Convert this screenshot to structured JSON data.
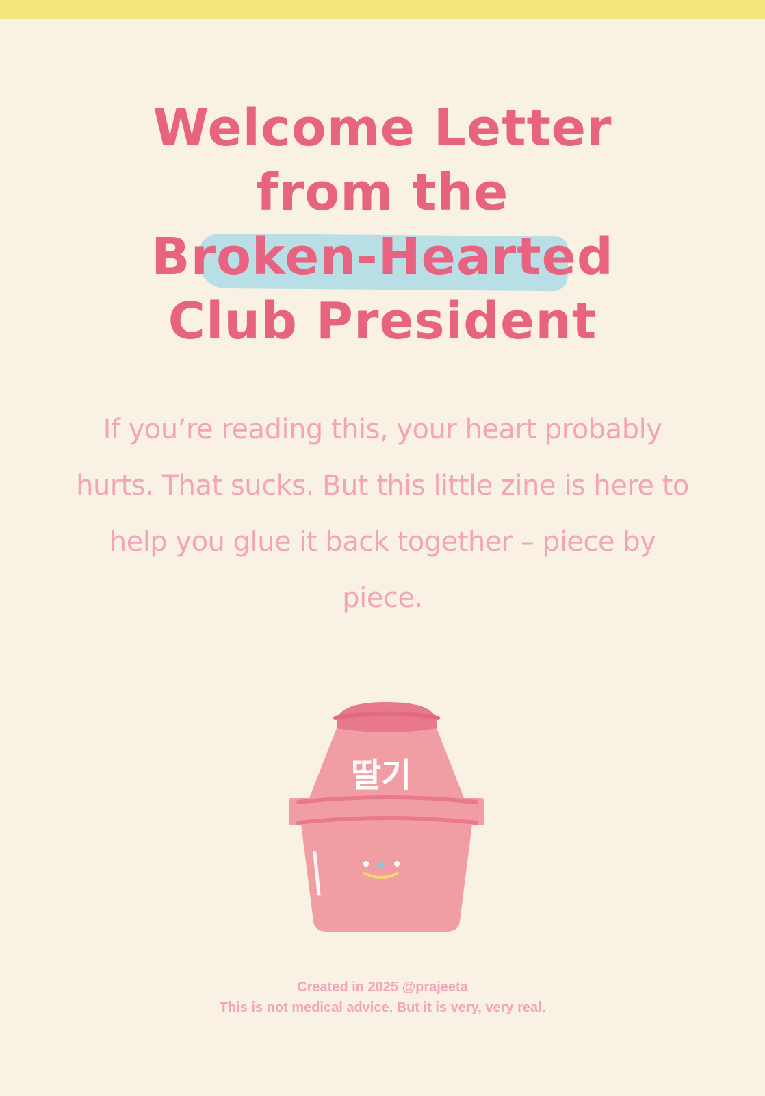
{
  "title": {
    "line1": "Welcome Letter",
    "line2": "from the",
    "line3": "Broken-Hearted",
    "line4": "Club President"
  },
  "intro": "If you’re reading this, your heart probably hurts. That sucks. But this little zine is here to help you glue it back together – piece by piece.",
  "bottle": {
    "label": "딸기",
    "icon": "strawberry-milk-bottle-icon"
  },
  "footer": {
    "credit": "Created in 2025 @prajeeta",
    "disclaimer": "This is not medical advice. But it is very, very real."
  },
  "colors": {
    "background": "#f9f1e4",
    "top_bar": "#f3e57a",
    "title": "#e8637f",
    "highlight": "#b9dfe6",
    "body_text": "#f3a4b8",
    "bottle_body": "#f09ea3",
    "bottle_dark": "#e8788c"
  }
}
